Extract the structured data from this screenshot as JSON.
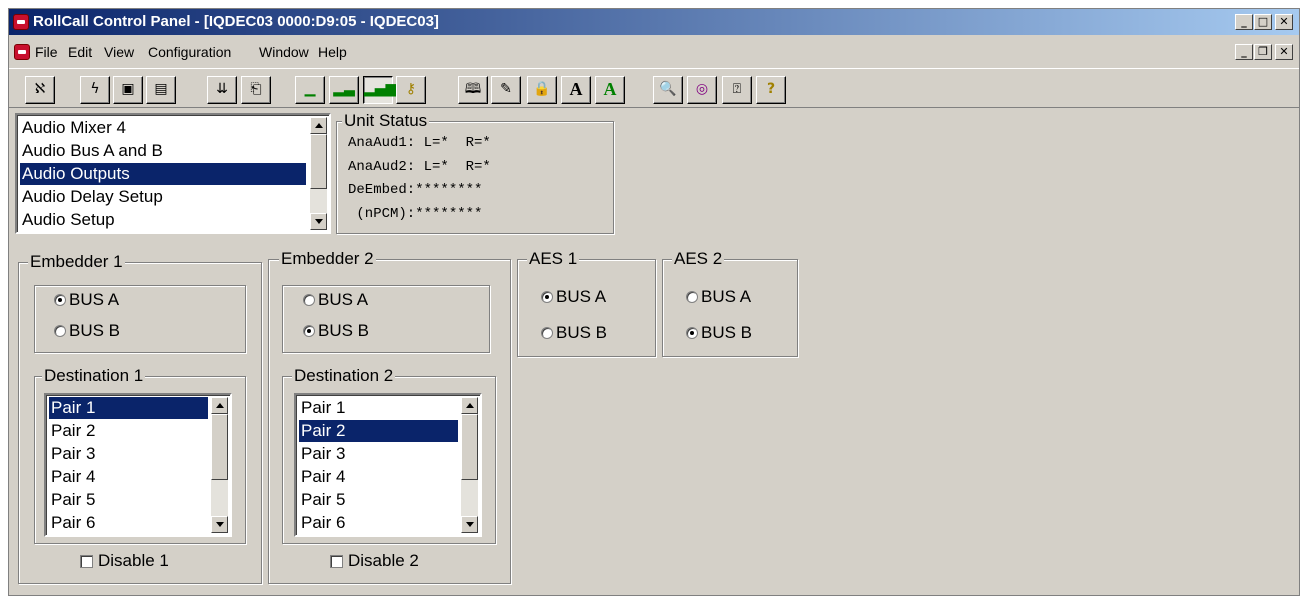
{
  "window": {
    "title": "RollCall Control Panel - [IQDEC03 0000:D9:05 - IQDEC03]",
    "caption_buttons": [
      "minimize-icon",
      "maximize-icon",
      "close-icon"
    ],
    "mdi_buttons": [
      "minimize-icon",
      "restore-icon",
      "close-icon"
    ]
  },
  "menu": [
    "File",
    "Edit",
    "View",
    "Configuration",
    "Window",
    "Help"
  ],
  "toolbar": {
    "groups": [
      [
        "connect-icon"
      ],
      [
        "lightning-icon",
        "save-icon",
        "save-all-icon"
      ],
      [
        "network-down-icon",
        "document-icon"
      ],
      [
        "level-1-icon",
        "level-2-icon",
        "level-3-icon",
        "key-icon"
      ],
      [
        "book-icon",
        "edit-icon",
        "lock-icon",
        "font-a-icon",
        "font-a-green-icon"
      ],
      [
        "search-icon",
        "cd-icon",
        "help-screen-icon",
        "help-icon"
      ]
    ]
  },
  "menu_list": {
    "items": [
      "Audio Mixer 4",
      "Audio Bus A and B",
      "Audio Outputs",
      "Audio Delay Setup",
      "Audio Setup"
    ],
    "selected": "Audio Outputs"
  },
  "unit_status": {
    "label": "Unit Status",
    "lines": [
      "AnaAud1: L=*  R=*",
      "AnaAud2: L=*  R=*",
      "DeEmbed:********",
      " (nPCM):********"
    ]
  },
  "embedder1": {
    "label": "Embedder 1",
    "bus_a": "BUS A",
    "bus_b": "BUS B",
    "bus_selected": "BUS A",
    "destination_label": "Destination 1",
    "pairs": [
      "Pair 1",
      "Pair 2",
      "Pair 3",
      "Pair 4",
      "Pair 5",
      "Pair 6"
    ],
    "pair_selected": "Pair 1",
    "disable_label": "Disable 1",
    "disable_checked": false
  },
  "embedder2": {
    "label": "Embedder 2",
    "bus_a": "BUS A",
    "bus_b": "BUS B",
    "bus_selected": "BUS B",
    "destination_label": "Destination 2",
    "pairs": [
      "Pair 1",
      "Pair 2",
      "Pair 3",
      "Pair 4",
      "Pair 5",
      "Pair 6"
    ],
    "pair_selected": "Pair 2",
    "disable_label": "Disable 2",
    "disable_checked": false
  },
  "aes1": {
    "label": "AES 1",
    "bus_a": "BUS A",
    "bus_b": "BUS B",
    "bus_selected": "BUS A"
  },
  "aes2": {
    "label": "AES 2",
    "bus_a": "BUS A",
    "bus_b": "BUS B",
    "bus_selected": "BUS B"
  },
  "colors": {
    "titlebar_start": "#0a246a",
    "titlebar_end": "#a6caf0",
    "selection": "#0a246a",
    "face": "#d4d0c8"
  }
}
